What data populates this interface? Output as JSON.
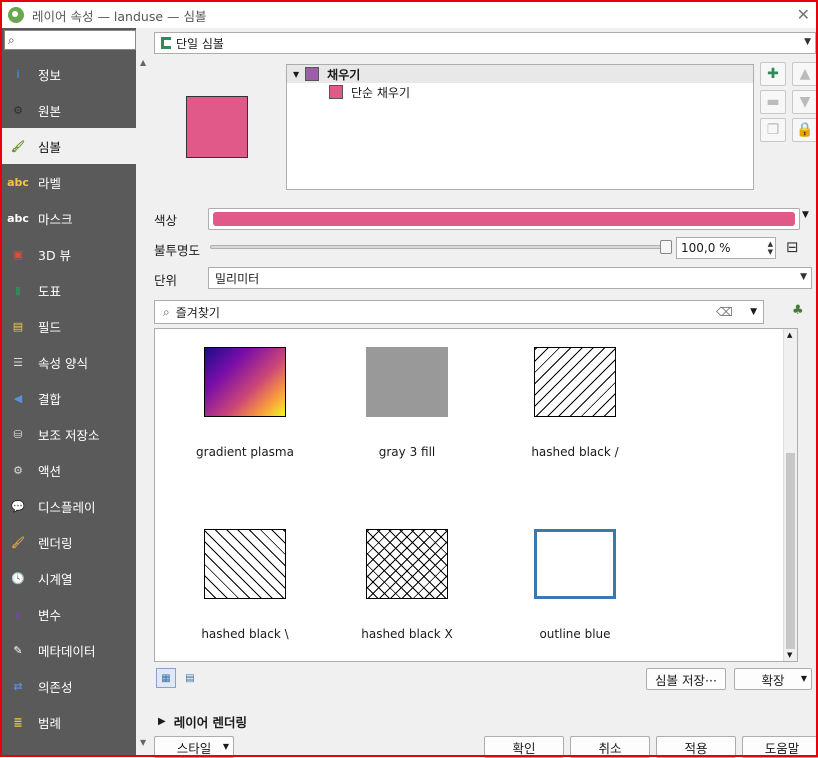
{
  "window": {
    "title": "레이어 속성 — landuse — 심볼",
    "close_glyph": "✕"
  },
  "sidebar": {
    "search_placeholder": "",
    "items": [
      {
        "label": "정보",
        "icon": "info-icon",
        "glyph": "i",
        "color": "#3b82c4"
      },
      {
        "label": "원본",
        "icon": "source-gears-icon",
        "glyph": "⚙",
        "color": "#2f2f2f"
      },
      {
        "label": "심볼",
        "icon": "paintbrush-icon",
        "glyph": "🖌",
        "color": "#6b8e23",
        "active": true
      },
      {
        "label": "라벨",
        "icon": "label-abc-icon",
        "glyph": "abc",
        "color": "#f2c744"
      },
      {
        "label": "마스크",
        "icon": "mask-abc-icon",
        "glyph": "abc",
        "color": "#ffffff"
      },
      {
        "label": "3D 뷰",
        "icon": "3d-cube-icon",
        "glyph": "▣",
        "color": "#e14b3b"
      },
      {
        "label": "도표",
        "icon": "diagram-icon",
        "glyph": "▮",
        "color": "#2e8b57"
      },
      {
        "label": "필드",
        "icon": "fields-table-icon",
        "glyph": "▤",
        "color": "#f2c744"
      },
      {
        "label": "속성 양식",
        "icon": "attributes-form-icon",
        "glyph": "☰",
        "color": "#dcdcdc"
      },
      {
        "label": "결합",
        "icon": "join-icon",
        "glyph": "◀",
        "color": "#5b8fd6"
      },
      {
        "label": "보조 저장소",
        "icon": "auxiliary-storage-icon",
        "glyph": "⛁",
        "color": "#dcdcdc"
      },
      {
        "label": "액션",
        "icon": "action-gear-icon",
        "glyph": "⚙",
        "color": "#dcdcdc"
      },
      {
        "label": "디스플레이",
        "icon": "display-bubble-icon",
        "glyph": "💬",
        "color": "#f2c744"
      },
      {
        "label": "렌더링",
        "icon": "rendering-brush-icon",
        "glyph": "🖌",
        "color": "#d4a04a"
      },
      {
        "label": "시계열",
        "icon": "clock-icon",
        "glyph": "🕓",
        "color": "#ffffff"
      },
      {
        "label": "변수",
        "icon": "variable-epsilon-icon",
        "glyph": "ε",
        "color": "#6b4c9a"
      },
      {
        "label": "메타데이터",
        "icon": "metadata-icon",
        "glyph": "✎",
        "color": "#ffffff"
      },
      {
        "label": "의존성",
        "icon": "dependencies-icon",
        "glyph": "⇄",
        "color": "#5b8fd6"
      },
      {
        "label": "범례",
        "icon": "legend-icon",
        "glyph": "≣",
        "color": "#f2c744"
      }
    ]
  },
  "renderer": {
    "type_label": "단일 심볼",
    "icon": "single-symbol-icon"
  },
  "symbol_tree": {
    "root_label": "채우기",
    "root_color": "#9c5fa7",
    "child_label": "단순 채우기",
    "child_color": "#e15989"
  },
  "symbol_color": "#e15989",
  "properties": {
    "color_label": "색상",
    "opacity_label": "불투명도",
    "opacity_value": "100,0 %",
    "opacity_percent": 100,
    "unit_label": "단위",
    "unit_value": "밀리미터"
  },
  "favorites": {
    "placeholder": "즐겨찾기",
    "items": [
      {
        "label": "gradient  plasma",
        "kind": "gradient"
      },
      {
        "label": "gray 3 fill",
        "kind": "gray"
      },
      {
        "label": "hashed black /",
        "kind": "hash-forward"
      },
      {
        "label": "hashed black \\",
        "kind": "hash-back"
      },
      {
        "label": "hashed black X",
        "kind": "hash-x"
      },
      {
        "label": "outline blue",
        "kind": "outline"
      }
    ]
  },
  "buttons": {
    "save_symbol": "심볼 저장···",
    "advanced": "확장",
    "layer_rendering": "레이어 렌더링",
    "style": "스타일",
    "ok": "확인",
    "cancel": "취소",
    "apply": "적용",
    "help": "도움말"
  }
}
